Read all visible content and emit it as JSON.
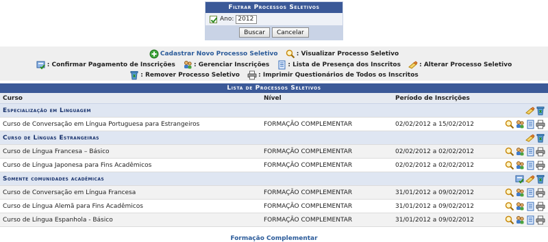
{
  "filter": {
    "title": "Filtrar Processos Seletivos",
    "ano_label": "Ano:",
    "ano_value": "2012",
    "buscar_label": "Buscar",
    "cancelar_label": "Cancelar"
  },
  "legend": {
    "cadastrar": "Cadastrar Novo Processo Seletivo",
    "visualizar": ": Visualizar Processo Seletivo",
    "confirmar": ": Confirmar Pagamento de Inscrições",
    "gerenciar": ": Gerenciar Inscrições",
    "presenca": ": Lista de Presença dos Inscritos",
    "alterar": ": Alterar Processo Seletivo",
    "remover": ": Remover Processo Seletivo",
    "imprimir": ": Imprimir Questionários de Todos os Inscritos"
  },
  "table": {
    "caption": "Lista de Processos Seletivos",
    "headers": {
      "curso": "Curso",
      "nivel": "Nível",
      "periodo": "Período de Inscrições"
    },
    "groups": [
      {
        "name": "Especialização em Linguagem",
        "rows": [
          {
            "curso": "Curso de Conversação em Língua Portuguesa para Estrangeiros",
            "nivel": "FORMAÇÃO COMPLEMENTAR",
            "periodo": "02/02/2012 a 15/02/2012"
          }
        ]
      },
      {
        "name": "Curso de Línguas Estrangeiras",
        "rows": [
          {
            "curso": "Curso de Língua Francesa – Básico",
            "nivel": "FORMAÇÃO COMPLEMENTAR",
            "periodo": "02/02/2012 a 02/02/2012"
          },
          {
            "curso": "Curso de Língua Japonesa para Fins Acadêmicos",
            "nivel": "FORMAÇÃO COMPLEMENTAR",
            "periodo": "02/02/2012 a 02/02/2012"
          }
        ]
      },
      {
        "name": "Somente comunidades acadêmicas",
        "rows": [
          {
            "curso": "Curso de Conversação em Língua Francesa",
            "nivel": "FORMAÇÃO COMPLEMENTAR",
            "periodo": "31/01/2012 a 09/02/2012"
          },
          {
            "curso": "Curso de Língua Alemã para Fins Acadêmicos",
            "nivel": "FORMAÇÃO COMPLEMENTAR",
            "periodo": "31/01/2012 a 09/02/2012"
          },
          {
            "curso": "Curso de Língua Espanhola - Básico",
            "nivel": "FORMAÇÃO COMPLEMENTAR",
            "periodo": "31/01/2012 a 09/02/2012"
          }
        ]
      }
    ]
  },
  "footer": {
    "link": "Formação Complementar"
  },
  "colors": {
    "header_blue": "#3b5998",
    "group_bg": "#dfe6f2",
    "link_blue": "#2a5a99"
  }
}
